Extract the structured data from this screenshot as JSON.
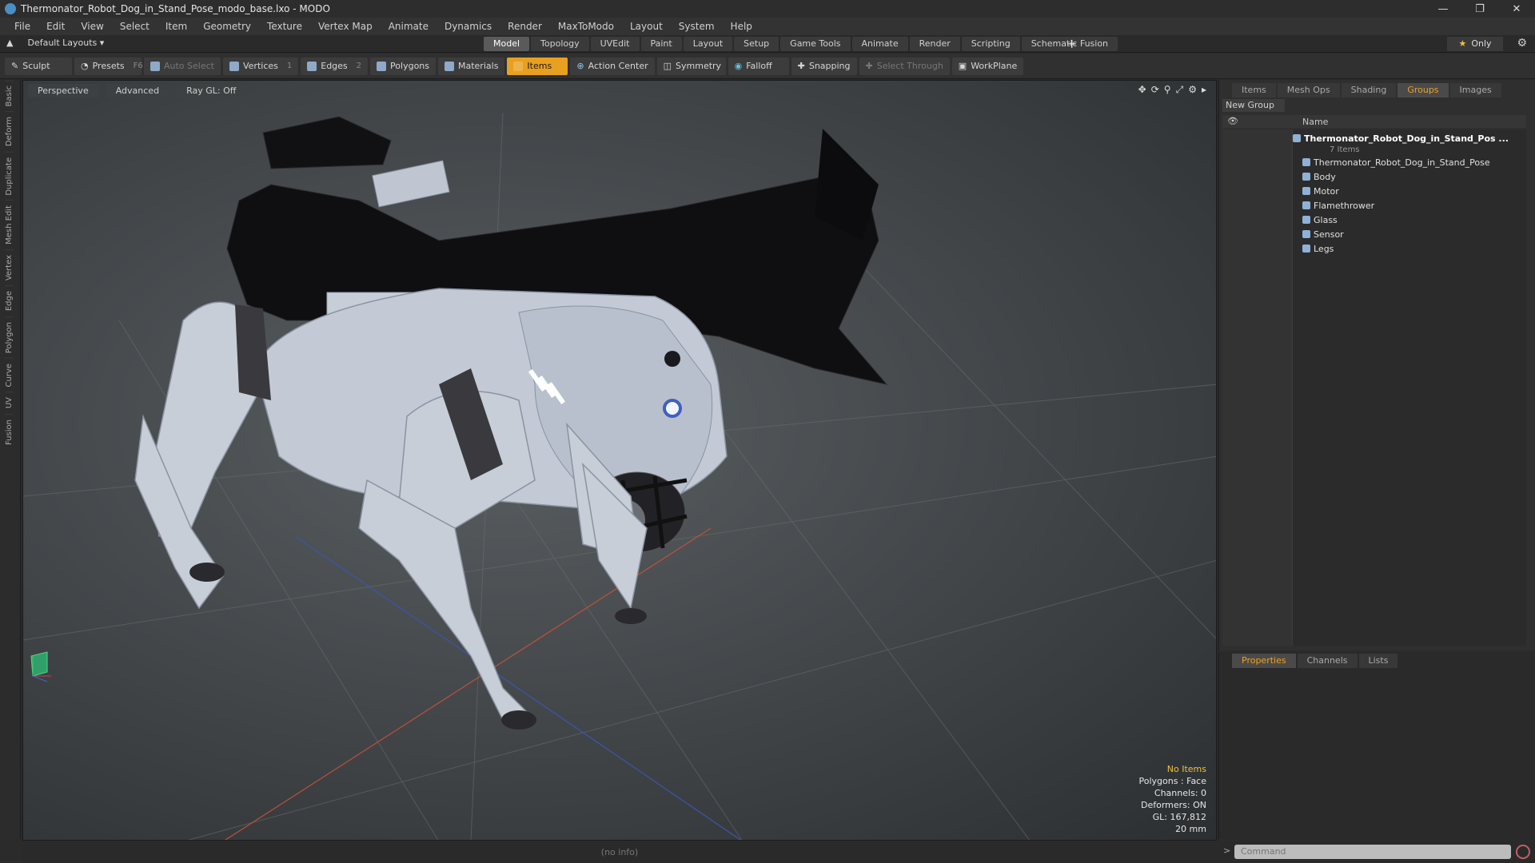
{
  "window": {
    "title": "Thermonator_Robot_Dog_in_Stand_Pose_modo_base.lxo - MODO"
  },
  "menu": [
    "File",
    "Edit",
    "View",
    "Select",
    "Item",
    "Geometry",
    "Texture",
    "Vertex Map",
    "Animate",
    "Dynamics",
    "Render",
    "MaxToModo",
    "Layout",
    "System",
    "Help"
  ],
  "layout": {
    "dropdown": "Default Layouts",
    "tabs": [
      "Model",
      "Topology",
      "UVEdit",
      "Paint",
      "Layout",
      "Setup",
      "Game Tools",
      "Animate",
      "Render",
      "Scripting",
      "Schematic Fusion"
    ],
    "active_tab": "Model",
    "only_label": "Only"
  },
  "toolbar": {
    "sculpt": "Sculpt",
    "presets": "Presets",
    "presets_key": "F6",
    "auto_select": "Auto Select",
    "vertices": "Vertices",
    "vertices_key": "1",
    "edges": "Edges",
    "edges_key": "2",
    "polygons": "Polygons",
    "materials": "Materials",
    "items": "Items",
    "action_center": "Action Center",
    "symmetry": "Symmetry",
    "falloff": "Falloff",
    "snapping": "Snapping",
    "select_through": "Select Through",
    "workplane": "WorkPlane"
  },
  "left_tabs": [
    "Basic",
    "Deform",
    "Duplicate",
    "Mesh Edit",
    "Vertex",
    "Edge",
    "Polygon",
    "Curve",
    "UV",
    "Fusion"
  ],
  "viewport": {
    "view": "Perspective",
    "shading": "Advanced",
    "raygl": "Ray GL: Off",
    "info": {
      "items": "No Items",
      "polygons": "Polygons : Face",
      "channels": "Channels: 0",
      "deformers": "Deformers: ON",
      "gl": "GL: 167,812",
      "scale": "20 mm"
    }
  },
  "status": "(no info)",
  "right_panel": {
    "tabs": [
      "Items",
      "Mesh Ops",
      "Shading",
      "Groups",
      "Images"
    ],
    "active_tab": "Groups",
    "new_group": "New Group",
    "column_name": "Name",
    "root": "Thermonator_Robot_Dog_in_Stand_Pos ...",
    "root_count": "7 Items",
    "children": [
      "Thermonator_Robot_Dog_in_Stand_Pose",
      "Body",
      "Motor",
      "Flamethrower",
      "Glass",
      "Sensor",
      "Legs"
    ]
  },
  "props_panel": {
    "tabs": [
      "Properties",
      "Channels",
      "Lists"
    ],
    "active_tab": "Properties"
  },
  "command": {
    "placeholder": "Command"
  },
  "colors": {
    "accent": "#e8a020",
    "viewport_bg": "#45494c",
    "robot_body": "#c3cad6",
    "gun": "#0f0f12"
  }
}
